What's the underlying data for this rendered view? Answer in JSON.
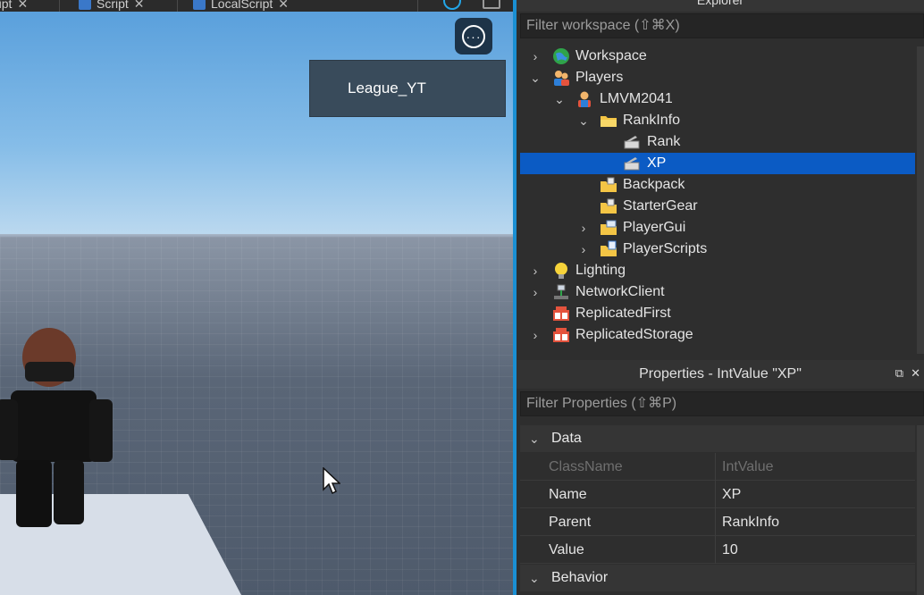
{
  "tabs": [
    {
      "label": "ript"
    },
    {
      "label": "Script"
    },
    {
      "label": "LocalScript"
    }
  ],
  "viewport": {
    "player_name": "League_YT",
    "more_label": "···"
  },
  "explorer": {
    "title": "Explorer",
    "filter_placeholder": "Filter workspace (⇧⌘X)",
    "items": [
      {
        "label": "Workspace",
        "icon": "globe-icon",
        "chev": "›"
      },
      {
        "label": "Players",
        "icon": "players-icon",
        "chev": "⌄"
      },
      {
        "label": "LMVM2041",
        "icon": "player-icon",
        "chev": "⌄"
      },
      {
        "label": "RankInfo",
        "icon": "folder-icon",
        "chev": "⌄"
      },
      {
        "label": "Rank",
        "icon": "value-icon",
        "chev": ""
      },
      {
        "label": "XP",
        "icon": "value-icon",
        "chev": ""
      },
      {
        "label": "Backpack",
        "icon": "backpack-icon",
        "chev": ""
      },
      {
        "label": "StarterGear",
        "icon": "startergear-icon",
        "chev": ""
      },
      {
        "label": "PlayerGui",
        "icon": "playergui-icon",
        "chev": "›"
      },
      {
        "label": "PlayerScripts",
        "icon": "playerscripts-icon",
        "chev": "›"
      },
      {
        "label": "Lighting",
        "icon": "lightbulb-icon",
        "chev": "›"
      },
      {
        "label": "NetworkClient",
        "icon": "network-icon",
        "chev": "›"
      },
      {
        "label": "ReplicatedFirst",
        "icon": "replicated-icon",
        "chev": ""
      },
      {
        "label": "ReplicatedStorage",
        "icon": "replicated-icon",
        "chev": "›"
      }
    ]
  },
  "properties": {
    "title": "Properties - IntValue \"XP\"",
    "filter_placeholder": "Filter Properties (⇧⌘P)",
    "sections": [
      {
        "title": "Data"
      },
      {
        "title": "Behavior"
      }
    ],
    "rows": [
      {
        "name": "ClassName",
        "value": "IntValue"
      },
      {
        "name": "Name",
        "value": "XP"
      },
      {
        "name": "Parent",
        "value": "RankInfo"
      },
      {
        "name": "Value",
        "value": "10"
      }
    ]
  },
  "colors": {
    "accent": "#1a8fd3",
    "selection": "#0b5bc4",
    "panel_bg": "#2e2e2e"
  }
}
